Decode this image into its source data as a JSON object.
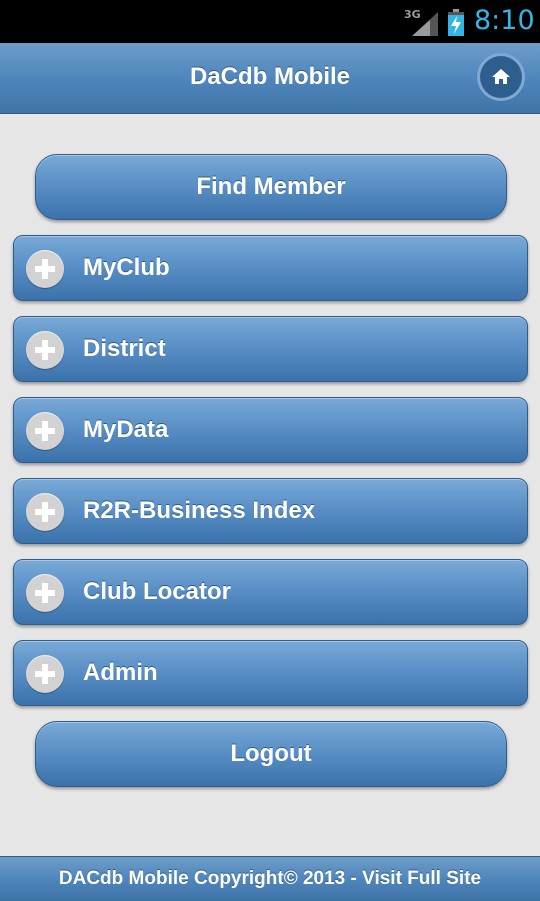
{
  "status_bar": {
    "network": "3G",
    "time": "8:10",
    "time_color": "#33b5e5"
  },
  "header": {
    "title": "DaCdb Mobile",
    "home_icon": "home-icon"
  },
  "buttons": {
    "find_member": "Find Member",
    "logout": "Logout"
  },
  "menu": {
    "items": [
      {
        "label": "MyClub",
        "icon": "plus-circle-icon"
      },
      {
        "label": "District",
        "icon": "plus-circle-icon"
      },
      {
        "label": "MyData",
        "icon": "plus-circle-icon"
      },
      {
        "label": "R2R-Business Index",
        "icon": "plus-circle-icon"
      },
      {
        "label": "Club Locator",
        "icon": "plus-circle-icon"
      },
      {
        "label": "Admin",
        "icon": "plus-circle-icon"
      }
    ]
  },
  "footer": {
    "text": "DACdb Mobile Copyright© 2013 - Visit Full Site"
  },
  "colors": {
    "accent": "#4f86bb",
    "background": "#e6e6e6"
  }
}
